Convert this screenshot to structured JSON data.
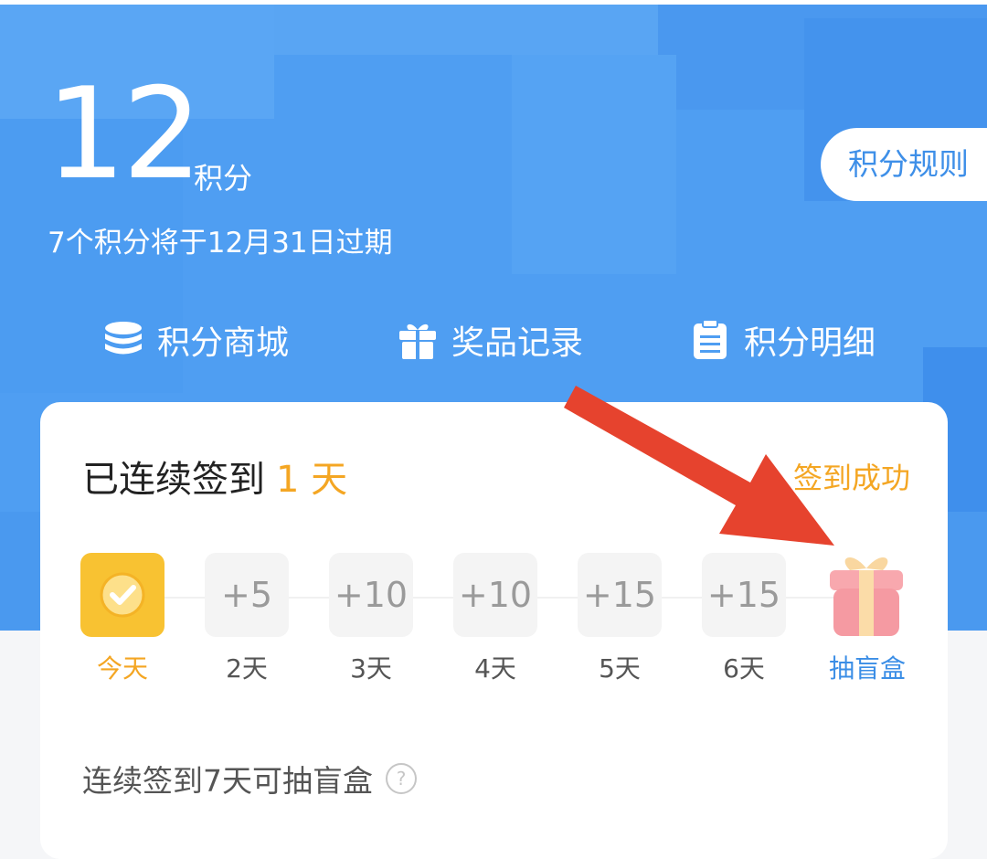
{
  "header": {
    "points_value": "12",
    "points_unit": "积分",
    "expire_notice": "7个积分将于12月31日过期",
    "rules_button": "积分规则"
  },
  "nav": [
    {
      "label": "积分商城",
      "icon": "coins-stack-icon"
    },
    {
      "label": "奖品记录",
      "icon": "gift-box-icon"
    },
    {
      "label": "积分明细",
      "icon": "clipboard-list-icon"
    }
  ],
  "checkin": {
    "title": "已连续签到",
    "days_text": "1 天",
    "status": "签到成功",
    "days": [
      {
        "box": "",
        "label": "今天",
        "checked": true
      },
      {
        "box": "+5",
        "label": "2天"
      },
      {
        "box": "+10",
        "label": "3天"
      },
      {
        "box": "+10",
        "label": "4天"
      },
      {
        "box": "+15",
        "label": "5天"
      },
      {
        "box": "+15",
        "label": "6天"
      },
      {
        "box": "",
        "label": "抽盲盒",
        "icon": "gift-icon"
      }
    ],
    "note": "连续签到7天可抽盲盒",
    "help_icon": "question-circle-icon"
  },
  "colors": {
    "hero_blue": "#4f9ef2",
    "accent_orange": "#f4a623",
    "link_blue": "#3b8ee6",
    "annotation_red": "#e6432e"
  }
}
